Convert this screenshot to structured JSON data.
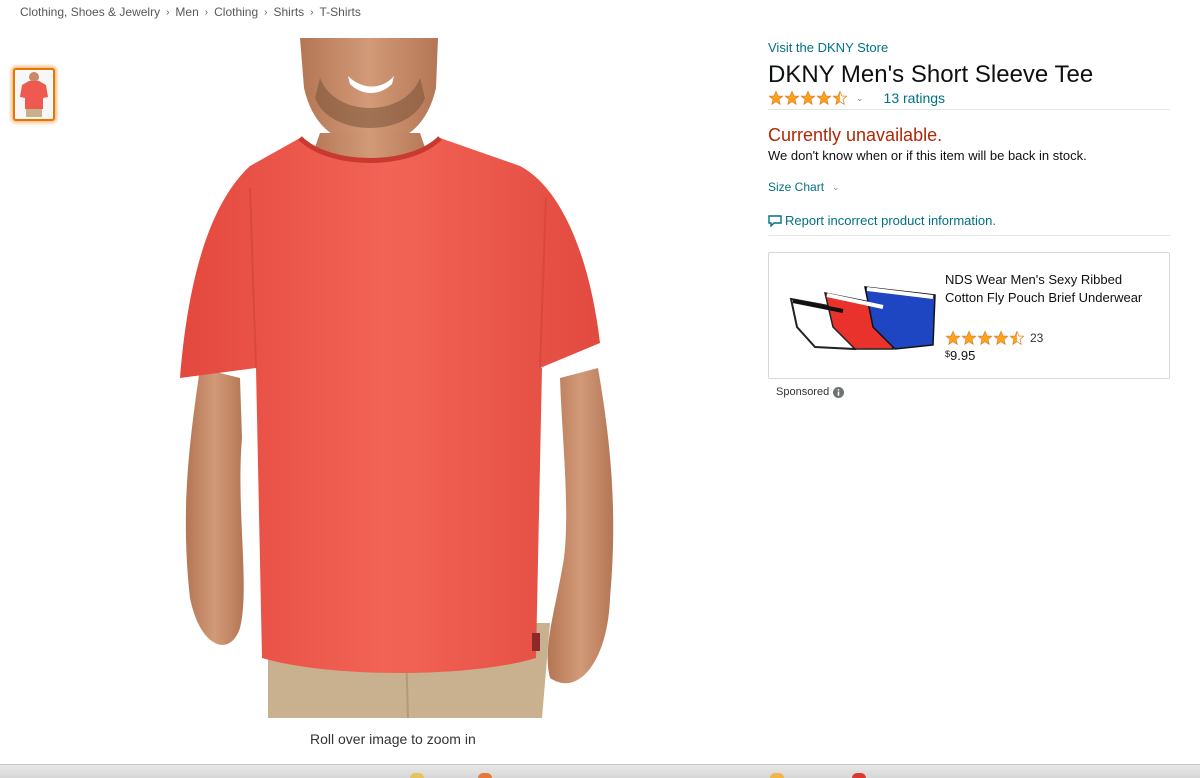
{
  "breadcrumb": [
    {
      "label": "Clothing, Shoes & Jewelry"
    },
    {
      "label": "Men"
    },
    {
      "label": "Clothing"
    },
    {
      "label": "Shirts"
    },
    {
      "label": "T-Shirts"
    }
  ],
  "breadcrumb_separator": "›",
  "gallery": {
    "thumbnail_alt": "Red t-shirt thumbnail",
    "zoom_hint": "Roll over image to zoom in",
    "shirt_color": "#ee5a4f"
  },
  "product": {
    "store_link": "Visit the DKNY Store",
    "title": "DKNY Men's Short Sleeve Tee",
    "rating_stars": 4.5,
    "ratings_count": "13 ratings",
    "availability": "Currently unavailable.",
    "availability_note": "We don't know when or if this item will be back in stock.",
    "size_chart": "Size Chart",
    "report": "Report incorrect product information."
  },
  "sponsored_ad": {
    "title": "NDS Wear Men's Sexy Ribbed Cotton Fly Pouch Brief Underwear",
    "rating_stars": 4.5,
    "rating_count": "23",
    "price_symbol": "$",
    "price": "9.95",
    "sponsored_label": "Sponsored"
  },
  "colors": {
    "link": "#007185",
    "unavailable": "#b12704",
    "star": "#ffa41c",
    "thumb_border": "#e77600"
  }
}
